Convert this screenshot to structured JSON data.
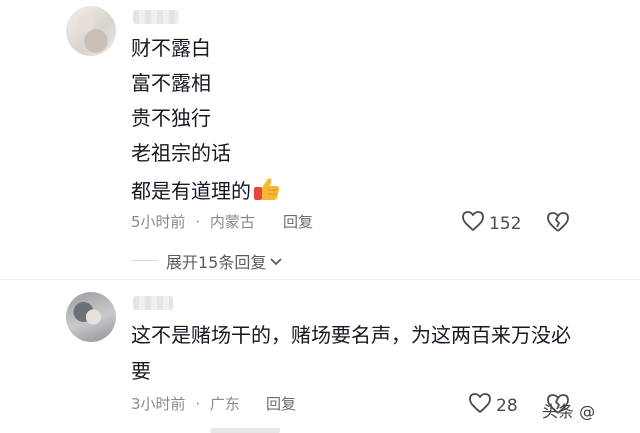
{
  "comment1": {
    "lines": [
      "财不露白",
      "富不露相",
      "贵不独行",
      "老祖宗的话",
      "都是有道理的"
    ],
    "emoji": "thumbs-up-emoji",
    "time": "5小时前",
    "location": "内蒙古",
    "sep": "·",
    "reply_label": "回复",
    "likes": "152",
    "expand_label": "展开15条回复"
  },
  "comment2": {
    "lines": [
      "这不是赌场干的，赌场要名声，为这两百来万没必",
      "要"
    ],
    "time": "3小时前",
    "location": "广东",
    "sep": "·",
    "reply_label": "回复",
    "likes": "28"
  },
  "watermark": "头条 @",
  "colors": {
    "text": "#161823",
    "meta": "#8a8b91",
    "thumb": "#f5b833",
    "sleeve": "#e8473f"
  }
}
